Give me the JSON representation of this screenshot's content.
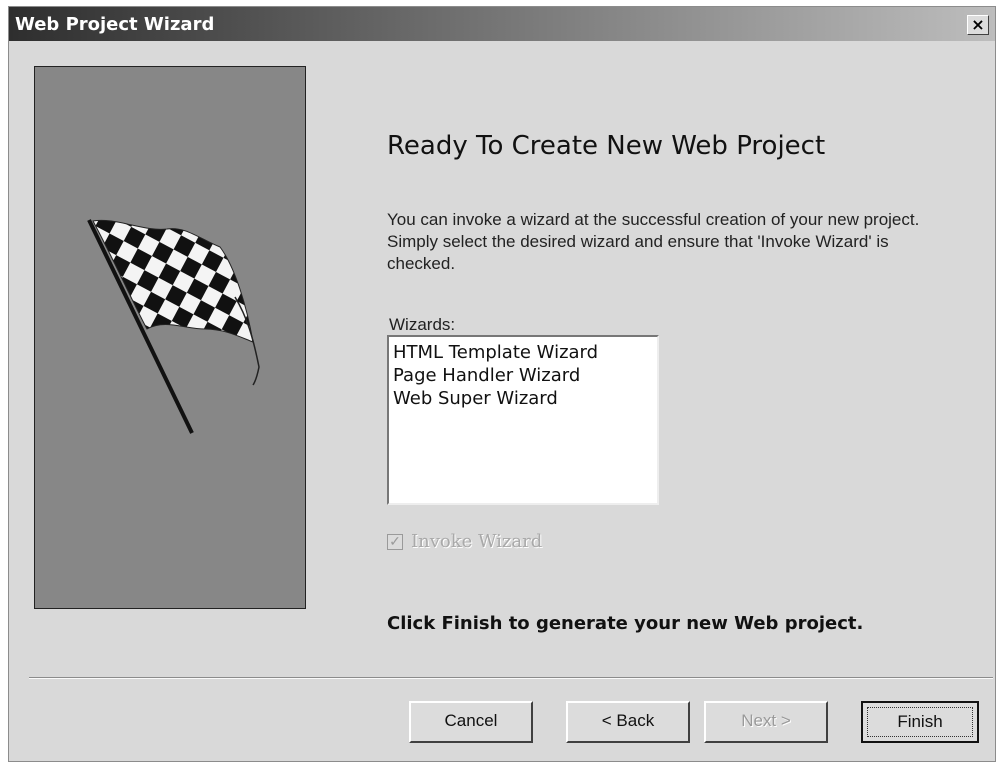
{
  "window": {
    "title": "Web Project Wizard",
    "close_symbol": "×"
  },
  "icons": {
    "close": "close-icon",
    "flag": "checkered-flag-icon",
    "check": "checkmark-icon"
  },
  "main": {
    "heading": "Ready To Create New Web Project",
    "description": "You can invoke a wizard at the successful creation of your new project.  Simply select the desired wizard and ensure that 'Invoke Wizard' is checked.",
    "wizards_label": "Wizards:",
    "wizards": [
      "HTML Template Wizard",
      "Page Handler Wizard",
      "Web Super Wizard"
    ],
    "invoke_checkbox": {
      "label": "Invoke Wizard",
      "checked": true,
      "enabled": false,
      "mark": "✓"
    },
    "finish_note": "Click Finish to generate your new Web project."
  },
  "buttons": {
    "cancel": "Cancel",
    "back": "< Back",
    "next": "Next >",
    "finish": "Finish"
  },
  "colors": {
    "panel_background": "#878787",
    "dialog_background": "#d9d9d9",
    "disabled_text": "#a9a9a9"
  }
}
